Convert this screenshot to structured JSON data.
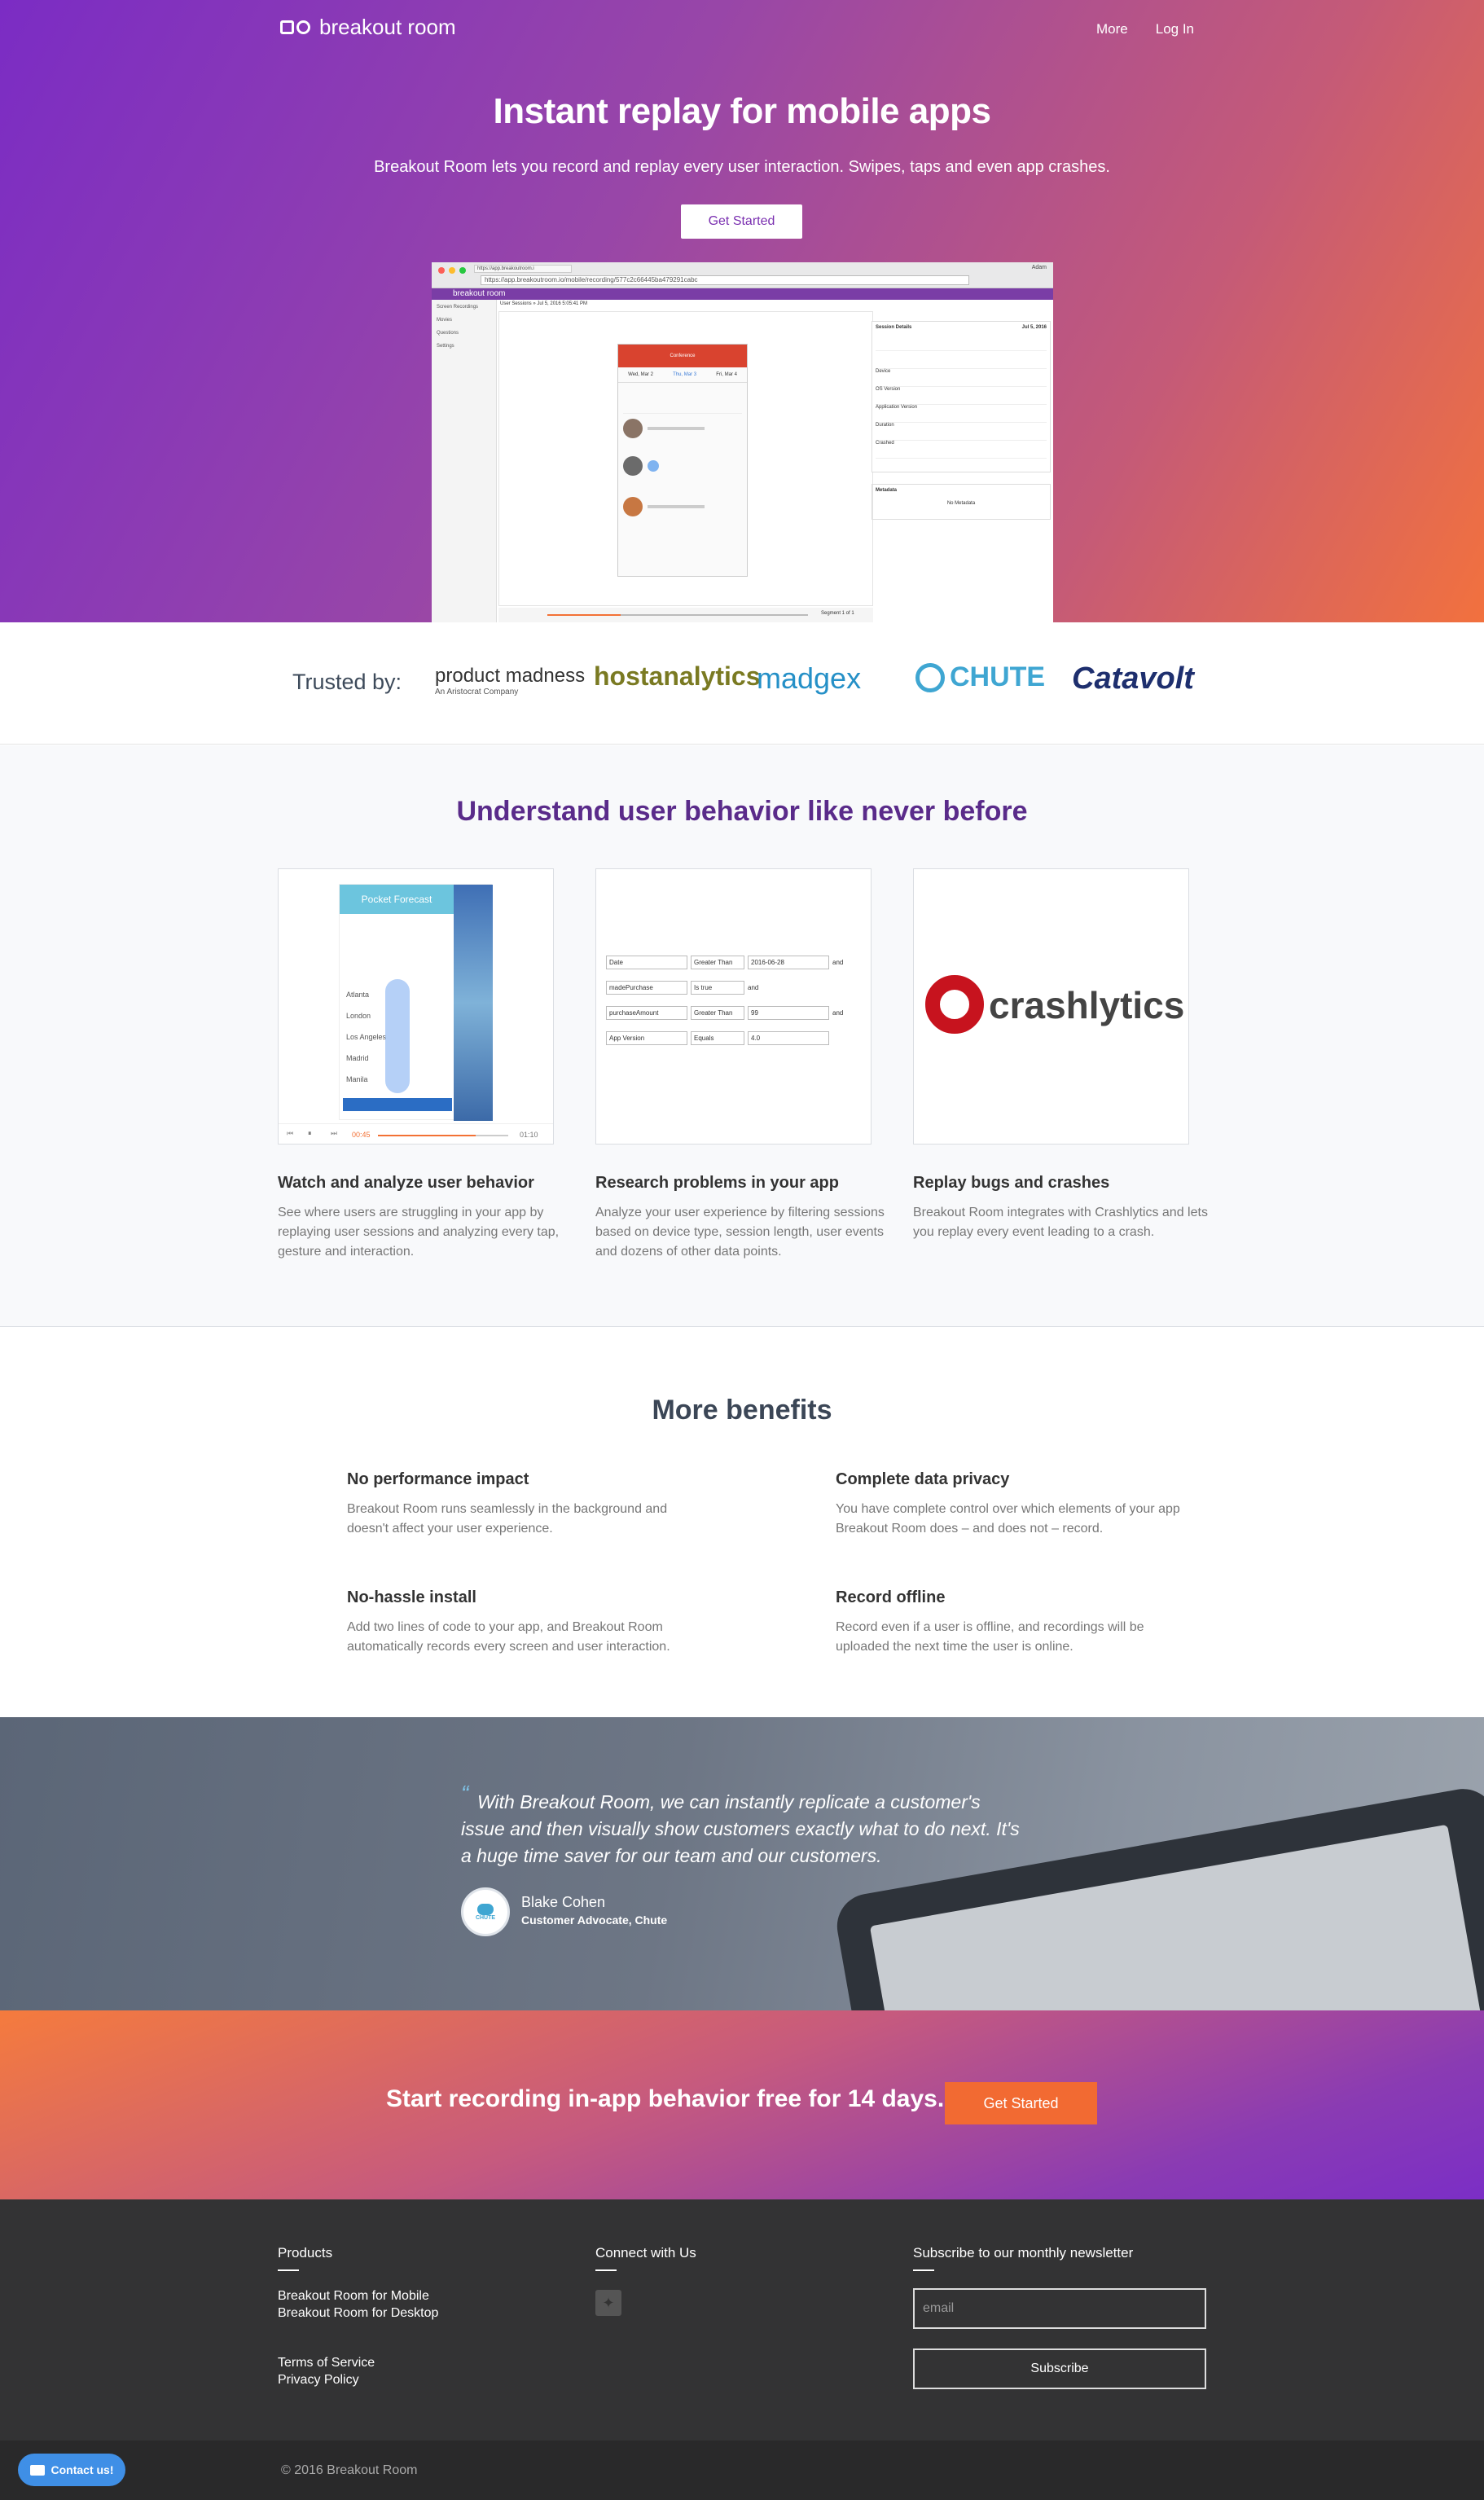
{
  "nav": {
    "logo_text": "breakout room",
    "more": "More",
    "login": "Log In"
  },
  "hero": {
    "title": "Instant replay for mobile apps",
    "subtitle": "Breakout Room lets you record and replay every user interaction. Swipes, taps and even app crashes.",
    "cta": "Get Started",
    "screenshot": {
      "url": "https://app.breakoutroom.io/mobile/recording/577c2c66445ba479291cabc",
      "tab": "https://app.breakoutroom.i",
      "account": "Adam",
      "sidebar": [
        "Screen Recordings",
        "Movies",
        "Questions",
        "Settings"
      ],
      "breadcrumb": "User Sessions » Jul 5, 2016 5:05:41 PM",
      "phone_header": "Conference",
      "days": [
        "Wed, Mar 2",
        "Thu, Mar 3",
        "Fri, Mar 4"
      ],
      "details_title": "Session Details",
      "details_date": "Jul 5, 2016",
      "details_rows": [
        "Device",
        "OS Version",
        "Application Version",
        "Duration",
        "Crashed"
      ],
      "metadata_label": "Metadata",
      "metadata_value": "No Metadata",
      "segment": "Segment 1 of 1"
    }
  },
  "trusted": {
    "label": "Trusted by:",
    "logos": [
      "product madness",
      "hostanalytics",
      "madgex",
      "CHUTE",
      "Catavolt"
    ],
    "pm_sub": "An Aristocrat Company"
  },
  "understand": {
    "title": "Understand user behavior like never before",
    "features": [
      {
        "title": "Watch and analyze user behavior",
        "text": "See where users are struggling in your app by replaying user sessions and analyzing every tap, gesture and interaction."
      },
      {
        "title": "Research problems in your app",
        "text": "Analyze your user experience by filtering sessions based on device type, session length, user events and dozens of other data points."
      },
      {
        "title": "Replay bugs and crashes",
        "text": "Breakout Room integrates with Crashlytics and lets you replay every event leading to a crash."
      }
    ],
    "phone_title": "Pocket Forecast",
    "cities": [
      "Atlanta",
      "London",
      "Los Angeles",
      "Madrid",
      "Manila"
    ],
    "time_start": "00:45",
    "time_end": "01:10",
    "filters": [
      {
        "field": "Date",
        "op": "Greater Than",
        "value": "2016-06-28",
        "join": "and"
      },
      {
        "field": "madePurchase",
        "op": "Is true",
        "value": "",
        "join": "and"
      },
      {
        "field": "purchaseAmount",
        "op": "Greater Than",
        "value": "99",
        "join": "and"
      },
      {
        "field": "App Version",
        "op": "Equals",
        "value": "4.0",
        "join": ""
      }
    ],
    "crashlytics": "crashlytics"
  },
  "benefits": {
    "title": "More benefits",
    "items": [
      {
        "title": "No performance impact",
        "text": "Breakout Room runs seamlessly in the background and doesn't affect your user experience."
      },
      {
        "title": "Complete data privacy",
        "text": "You have complete control over which elements of your app Breakout Room does – and does not – record."
      },
      {
        "title": "No-hassle install",
        "text": "Add two lines of code to your app, and Breakout Room automatically records every screen and user interaction."
      },
      {
        "title": "Record offline",
        "text": "Record even if a user is offline, and recordings will be uploaded the next time the user is online."
      }
    ]
  },
  "quote": {
    "mark": "“",
    "text": "With Breakout Room, we can instantly replicate a customer's issue and then visually show customers exactly what to do next. It's a huge time saver for our team and our customers.",
    "name": "Blake Cohen",
    "role": "Customer Advocate, Chute",
    "avatar_label": "CHUTE"
  },
  "cta": {
    "text": "Start recording in-app behavior free for 14 days.",
    "button": "Get Started"
  },
  "footer": {
    "products_title": "Products",
    "products": [
      "Breakout Room for Mobile",
      "Breakout Room for Desktop"
    ],
    "legal": [
      "Terms of Service",
      "Privacy Policy"
    ],
    "connect_title": "Connect with Us",
    "newsletter_title": "Subscribe to our monthly newsletter",
    "email_placeholder": "email",
    "subscribe": "Subscribe",
    "copyright": "© 2016 Breakout Room",
    "contact": "Contact us!"
  }
}
